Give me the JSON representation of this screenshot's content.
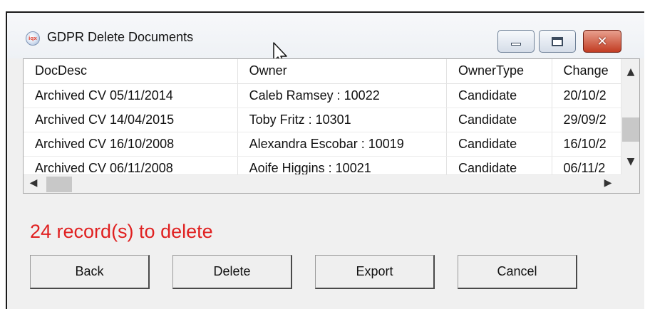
{
  "window": {
    "title": "GDPR Delete Documents",
    "app_icon": "gdpr-app-icon",
    "app_icon_text": "iqx",
    "controls": {
      "minimize": "minimize-icon",
      "maximize": "maximize-icon",
      "close": "close-icon"
    }
  },
  "grid": {
    "columns": [
      "DocDesc",
      "Owner",
      "OwnerType",
      "Change"
    ],
    "rows": [
      [
        "Archived CV 05/11/2014",
        "Caleb Ramsey : 10022",
        "Candidate",
        "20/10/2"
      ],
      [
        "Archived CV 14/04/2015",
        "Toby Fritz : 10301",
        "Candidate",
        "29/09/2"
      ],
      [
        "Archived CV 16/10/2008",
        "Alexandra Escobar : 10019",
        "Candidate",
        "16/10/2"
      ],
      [
        "Archived CV 06/11/2008",
        "Aoife Higgins : 10021",
        "Candidate",
        "06/11/2"
      ]
    ],
    "scroll_up": "^",
    "scroll_down": "v",
    "scroll_left": "<",
    "scroll_right": ">"
  },
  "status": {
    "text": "24 record(s) to delete",
    "color": "#e02020"
  },
  "buttons": {
    "back": "Back",
    "delete": "Delete",
    "export": "Export",
    "cancel": "Cancel"
  }
}
